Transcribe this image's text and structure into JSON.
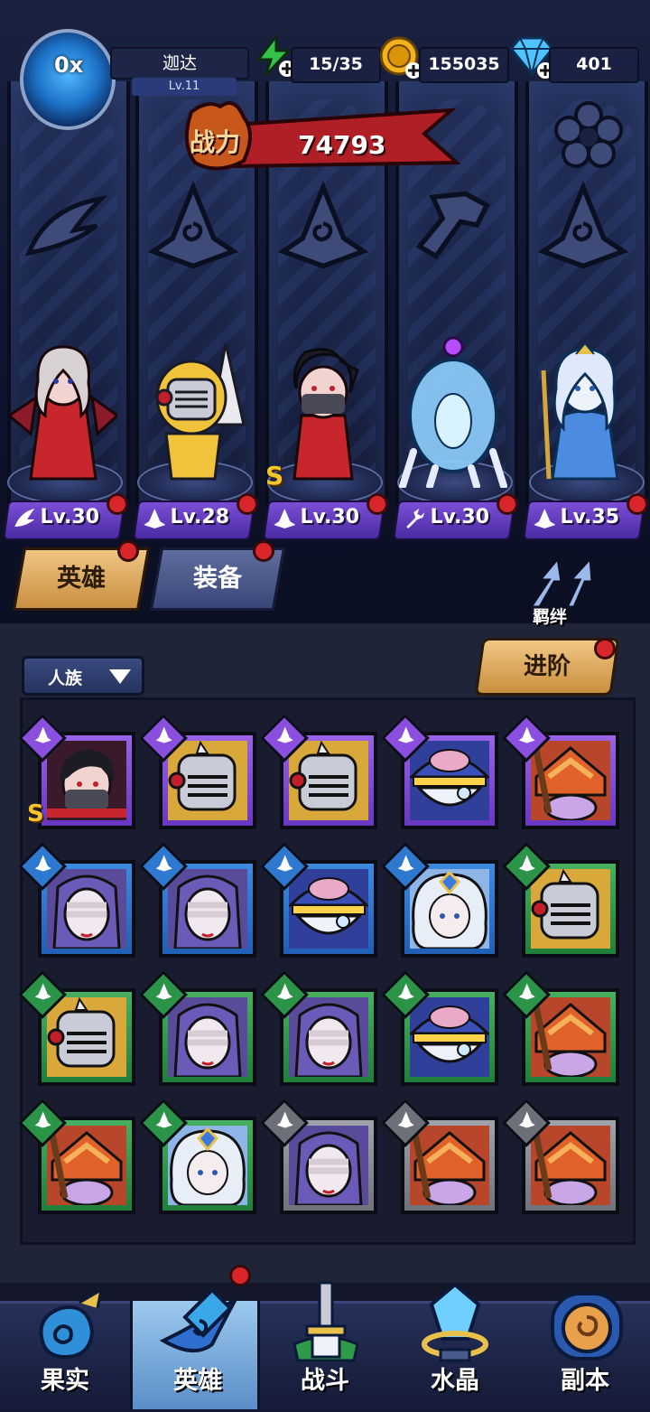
{
  "player": {
    "name": "迦达",
    "level": "Lv.11",
    "avatar_multiplier": "0x"
  },
  "resources": {
    "energy": "15/35",
    "gold": "155035",
    "diamond": "401"
  },
  "power": {
    "label": "战力",
    "value": "74793"
  },
  "lineup": [
    {
      "level": "Lv.30",
      "class_icon": "wing-icon",
      "has_alert": true
    },
    {
      "level": "Lv.28",
      "class_icon": "wizard-hat-icon",
      "has_alert": true
    },
    {
      "level": "Lv.30",
      "class_icon": "wizard-hat-icon",
      "has_alert": true,
      "rank": "S"
    },
    {
      "level": "Lv.30",
      "class_icon": "wrench-icon",
      "has_alert": true
    },
    {
      "level": "Lv.35",
      "class_icon": "wizard-hat-icon",
      "has_alert": true
    }
  ],
  "tabs": {
    "heroes": "英雄",
    "equipment": "装备",
    "bond": "羁绊"
  },
  "filter": {
    "selected": "人族"
  },
  "advance_button": "进阶",
  "roster": [
    {
      "rarity": "purple",
      "portrait": "ninja-portrait",
      "rank": "S"
    },
    {
      "rarity": "purple",
      "portrait": "knight-portrait"
    },
    {
      "rarity": "purple",
      "portrait": "knight-portrait"
    },
    {
      "rarity": "purple",
      "portrait": "brain-wizard-portrait"
    },
    {
      "rarity": "purple",
      "portrait": "hooded-elder-portrait"
    },
    {
      "rarity": "blue",
      "portrait": "bandaged-nun-portrait"
    },
    {
      "rarity": "blue",
      "portrait": "bandaged-nun-portrait"
    },
    {
      "rarity": "blue",
      "portrait": "brain-wizard-portrait"
    },
    {
      "rarity": "blue",
      "portrait": "ice-queen-portrait"
    },
    {
      "rarity": "green",
      "portrait": "knight-portrait"
    },
    {
      "rarity": "green",
      "portrait": "knight-portrait"
    },
    {
      "rarity": "green",
      "portrait": "bandaged-nun-portrait"
    },
    {
      "rarity": "green",
      "portrait": "bandaged-nun-portrait"
    },
    {
      "rarity": "green",
      "portrait": "brain-wizard-portrait"
    },
    {
      "rarity": "green",
      "portrait": "hooded-elder-portrait"
    },
    {
      "rarity": "green",
      "portrait": "hooded-elder-portrait"
    },
    {
      "rarity": "green",
      "portrait": "ice-queen-portrait"
    },
    {
      "rarity": "grey",
      "portrait": "bandaged-nun-portrait"
    },
    {
      "rarity": "grey",
      "portrait": "hooded-elder-portrait"
    },
    {
      "rarity": "grey",
      "portrait": "hooded-elder-portrait"
    }
  ],
  "nav": [
    {
      "label": "果实",
      "icon": "fruit-icon"
    },
    {
      "label": "英雄",
      "icon": "hero-hat-icon",
      "active": true,
      "has_alert": true
    },
    {
      "label": "战斗",
      "icon": "battle-sword-icon"
    },
    {
      "label": "水晶",
      "icon": "crystal-icon"
    },
    {
      "label": "副本",
      "icon": "dungeon-portal-icon"
    }
  ],
  "colors": {
    "rarity_purple": "#8a4fde",
    "rarity_blue": "#2e78d0",
    "rarity_green": "#2b9448",
    "rarity_grey": "#6d7079",
    "accent_gold": "#e8b45c",
    "alert_red": "#d9262a"
  }
}
